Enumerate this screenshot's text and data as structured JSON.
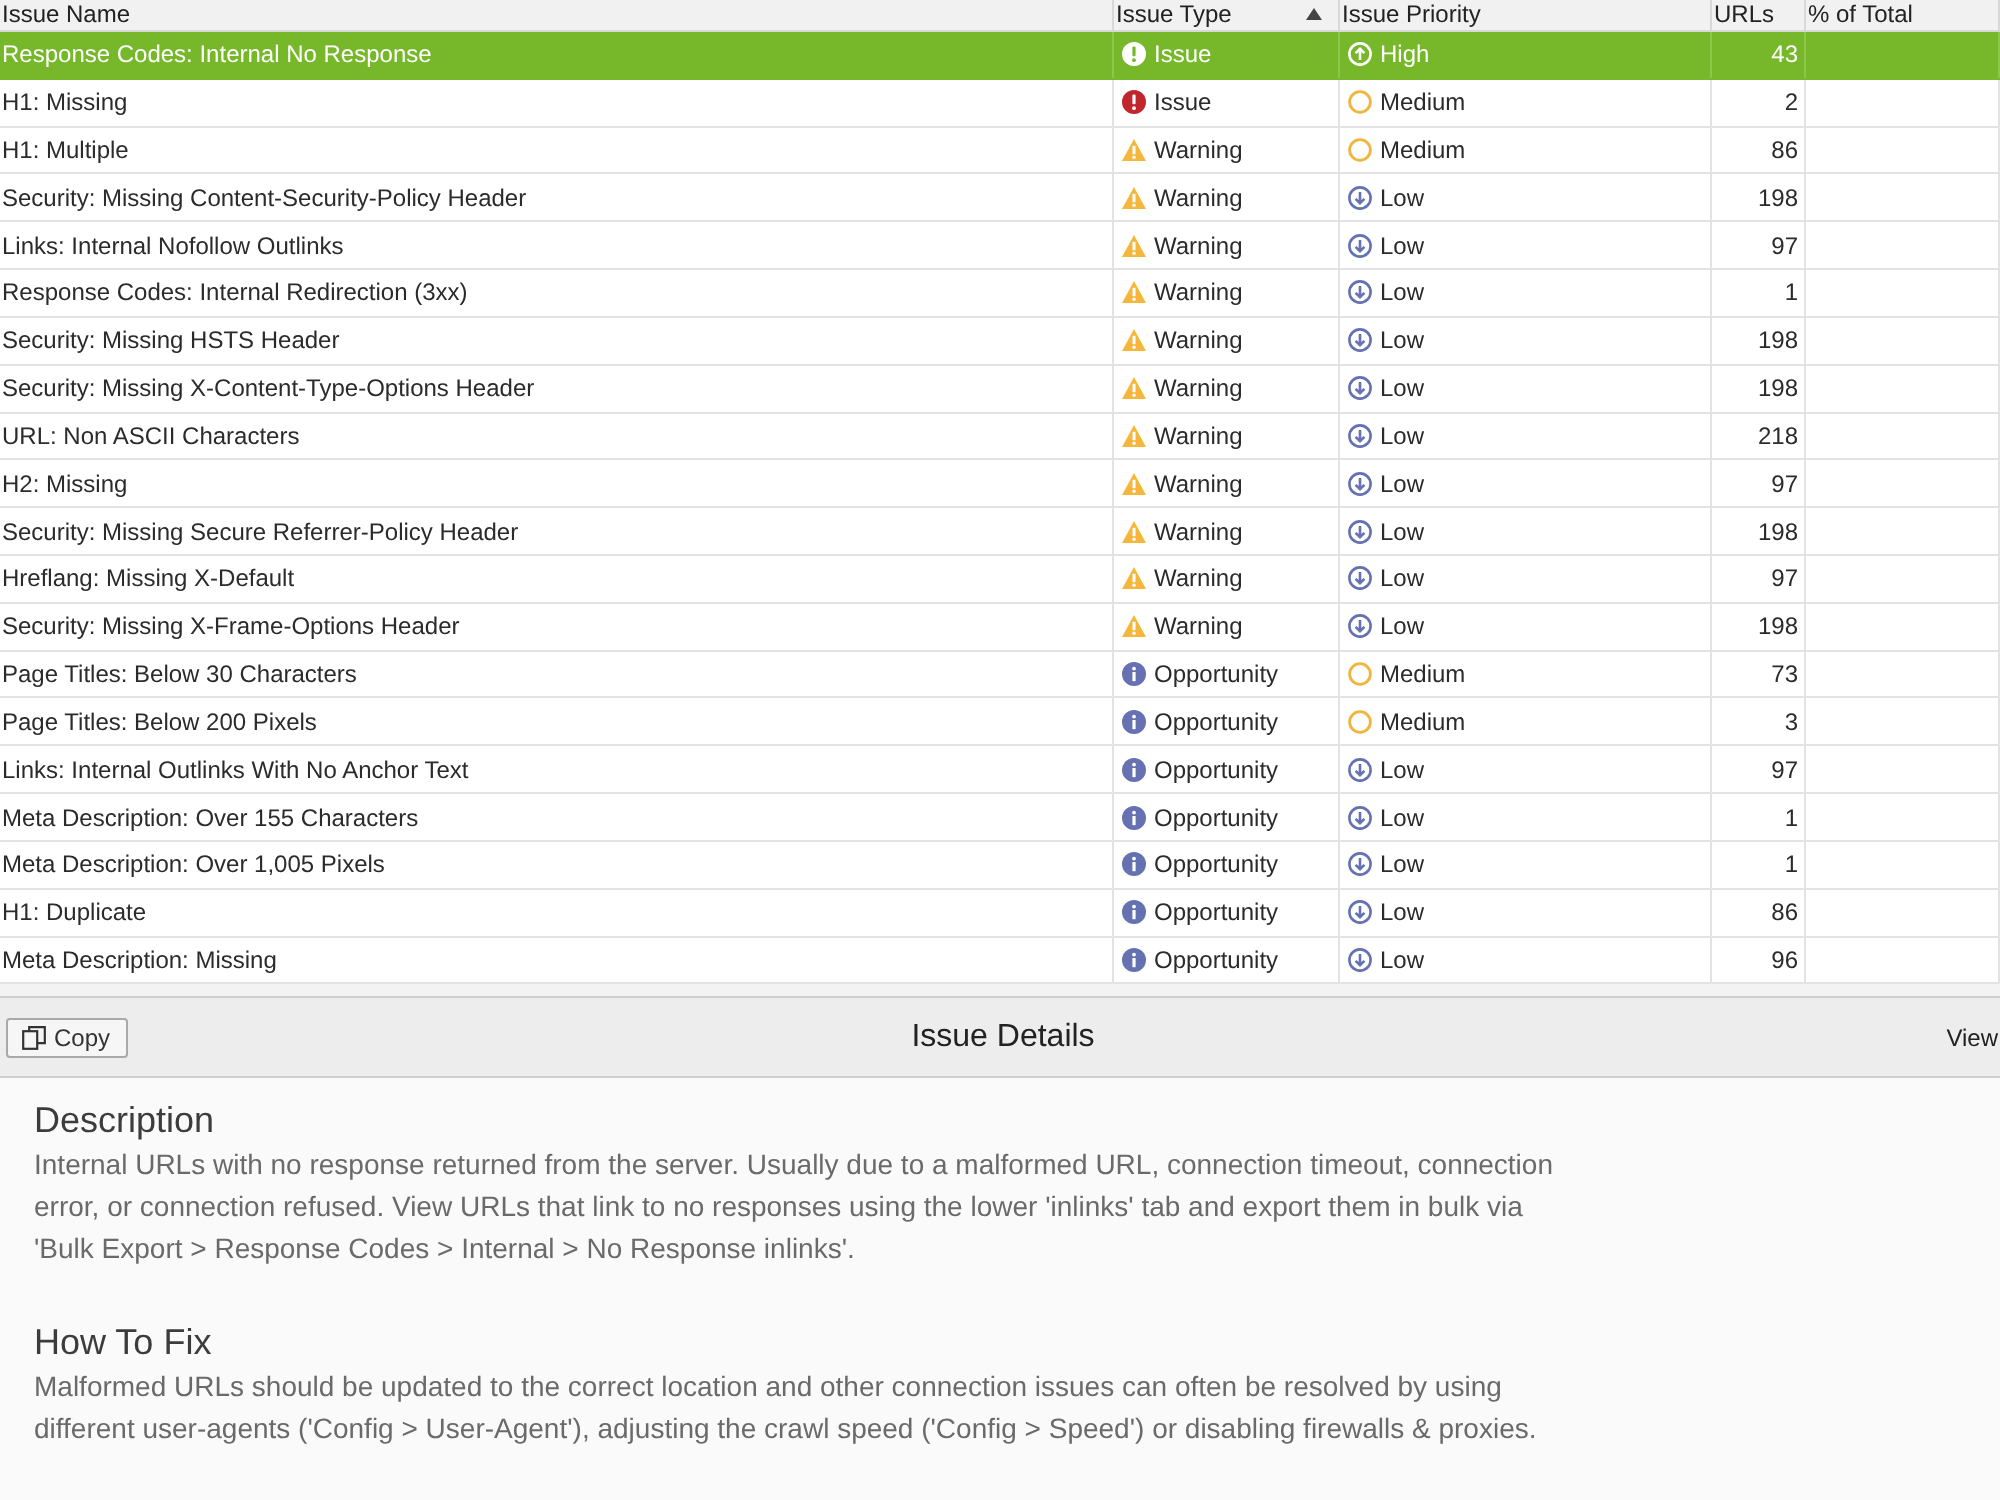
{
  "table": {
    "columns": [
      {
        "label": "Issue Name",
        "sorted": false
      },
      {
        "label": "Issue Type",
        "sorted": true
      },
      {
        "label": "Issue Priority",
        "sorted": false
      },
      {
        "label": "URLs",
        "sorted": false
      },
      {
        "label": "% of Total",
        "sorted": false
      }
    ],
    "rows": [
      {
        "name": "Response Codes: Internal No Response",
        "type": {
          "kind": "issue",
          "label": "Issue"
        },
        "priority": {
          "kind": "high",
          "label": "High"
        },
        "urls": "43",
        "selected": true
      },
      {
        "name": "H1: Missing",
        "type": {
          "kind": "issue",
          "label": "Issue"
        },
        "priority": {
          "kind": "medium",
          "label": "Medium"
        },
        "urls": "2",
        "selected": false
      },
      {
        "name": "H1: Multiple",
        "type": {
          "kind": "warning",
          "label": "Warning"
        },
        "priority": {
          "kind": "medium",
          "label": "Medium"
        },
        "urls": "86",
        "selected": false
      },
      {
        "name": "Security: Missing Content-Security-Policy Header",
        "type": {
          "kind": "warning",
          "label": "Warning"
        },
        "priority": {
          "kind": "low",
          "label": "Low"
        },
        "urls": "198",
        "selected": false
      },
      {
        "name": "Links: Internal Nofollow Outlinks",
        "type": {
          "kind": "warning",
          "label": "Warning"
        },
        "priority": {
          "kind": "low",
          "label": "Low"
        },
        "urls": "97",
        "selected": false
      },
      {
        "name": "Response Codes: Internal Redirection (3xx)",
        "type": {
          "kind": "warning",
          "label": "Warning"
        },
        "priority": {
          "kind": "low",
          "label": "Low"
        },
        "urls": "1",
        "selected": false
      },
      {
        "name": "Security: Missing HSTS Header",
        "type": {
          "kind": "warning",
          "label": "Warning"
        },
        "priority": {
          "kind": "low",
          "label": "Low"
        },
        "urls": "198",
        "selected": false
      },
      {
        "name": "Security: Missing X-Content-Type-Options Header",
        "type": {
          "kind": "warning",
          "label": "Warning"
        },
        "priority": {
          "kind": "low",
          "label": "Low"
        },
        "urls": "198",
        "selected": false
      },
      {
        "name": "URL: Non ASCII Characters",
        "type": {
          "kind": "warning",
          "label": "Warning"
        },
        "priority": {
          "kind": "low",
          "label": "Low"
        },
        "urls": "218",
        "selected": false
      },
      {
        "name": "H2: Missing",
        "type": {
          "kind": "warning",
          "label": "Warning"
        },
        "priority": {
          "kind": "low",
          "label": "Low"
        },
        "urls": "97",
        "selected": false
      },
      {
        "name": "Security: Missing Secure Referrer-Policy Header",
        "type": {
          "kind": "warning",
          "label": "Warning"
        },
        "priority": {
          "kind": "low",
          "label": "Low"
        },
        "urls": "198",
        "selected": false
      },
      {
        "name": "Hreflang: Missing X-Default",
        "type": {
          "kind": "warning",
          "label": "Warning"
        },
        "priority": {
          "kind": "low",
          "label": "Low"
        },
        "urls": "97",
        "selected": false
      },
      {
        "name": "Security: Missing X-Frame-Options Header",
        "type": {
          "kind": "warning",
          "label": "Warning"
        },
        "priority": {
          "kind": "low",
          "label": "Low"
        },
        "urls": "198",
        "selected": false
      },
      {
        "name": "Page Titles: Below 30 Characters",
        "type": {
          "kind": "opportunity",
          "label": "Opportunity"
        },
        "priority": {
          "kind": "medium",
          "label": "Medium"
        },
        "urls": "73",
        "selected": false
      },
      {
        "name": "Page Titles: Below 200 Pixels",
        "type": {
          "kind": "opportunity",
          "label": "Opportunity"
        },
        "priority": {
          "kind": "medium",
          "label": "Medium"
        },
        "urls": "3",
        "selected": false
      },
      {
        "name": "Links: Internal Outlinks With No Anchor Text",
        "type": {
          "kind": "opportunity",
          "label": "Opportunity"
        },
        "priority": {
          "kind": "low",
          "label": "Low"
        },
        "urls": "97",
        "selected": false
      },
      {
        "name": "Meta Description: Over 155 Characters",
        "type": {
          "kind": "opportunity",
          "label": "Opportunity"
        },
        "priority": {
          "kind": "low",
          "label": "Low"
        },
        "urls": "1",
        "selected": false
      },
      {
        "name": "Meta Description: Over 1,005 Pixels",
        "type": {
          "kind": "opportunity",
          "label": "Opportunity"
        },
        "priority": {
          "kind": "low",
          "label": "Low"
        },
        "urls": "1",
        "selected": false
      },
      {
        "name": "H1: Duplicate",
        "type": {
          "kind": "opportunity",
          "label": "Opportunity"
        },
        "priority": {
          "kind": "low",
          "label": "Low"
        },
        "urls": "86",
        "selected": false
      },
      {
        "name": "Meta Description: Missing",
        "type": {
          "kind": "opportunity",
          "label": "Opportunity"
        },
        "priority": {
          "kind": "low",
          "label": "Low"
        },
        "urls": "96",
        "selected": false
      }
    ]
  },
  "details": {
    "copy_button": "Copy",
    "title": "Issue Details",
    "view_button": "View",
    "sections": [
      {
        "heading": "Description",
        "text": "Internal URLs with no response returned from the server. Usually due to a malformed URL, connection timeout, connection error, or connection refused. View URLs that link to no responses using the lower 'inlinks' tab and export them in bulk via 'Bulk Export > Response Codes > Internal > No Response inlinks'."
      },
      {
        "heading": "How To Fix",
        "text": "Malformed URLs should be updated to the correct location and other connection issues can often be resolved by using different user-agents ('Config > User-Agent'), adjusting the crawl speed ('Config > Speed') or disabling firewalls & proxies."
      }
    ]
  }
}
